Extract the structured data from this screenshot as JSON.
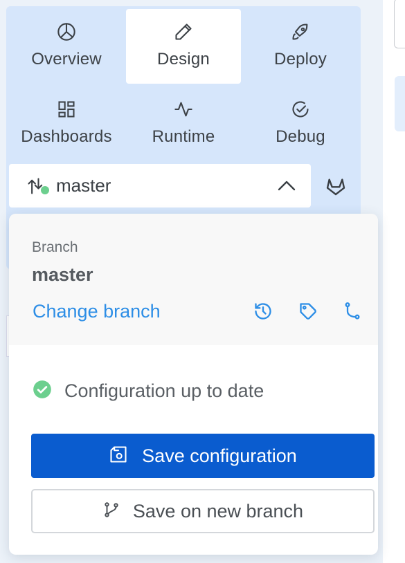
{
  "nav": {
    "items": [
      {
        "label": "Overview",
        "icon": "pie-chart-icon"
      },
      {
        "label": "Design",
        "icon": "pencil-icon",
        "active": true
      },
      {
        "label": "Deploy",
        "icon": "rocket-icon"
      },
      {
        "label": "Dashboards",
        "icon": "dashboard-grid-icon"
      },
      {
        "label": "Runtime",
        "icon": "activity-pulse-icon"
      },
      {
        "label": "Debug",
        "icon": "check-circle-icon"
      }
    ]
  },
  "branch_selector": {
    "value": "master",
    "status_color": "#6ccf8e",
    "provider_icon": "gitlab-icon"
  },
  "popover": {
    "branch_label": "Branch",
    "branch_name": "master",
    "change_branch_link": "Change branch",
    "actions": [
      "history-icon",
      "tag-icon",
      "branch-merge-icon"
    ],
    "status_text": "Configuration up to date",
    "save_button": "Save configuration",
    "save_new_branch_button": "Save on new branch"
  },
  "colors": {
    "accent": "#0a5ccf",
    "link": "#2d8ee6",
    "success": "#6ccf8e",
    "nav_bg": "#d6e6fb"
  }
}
